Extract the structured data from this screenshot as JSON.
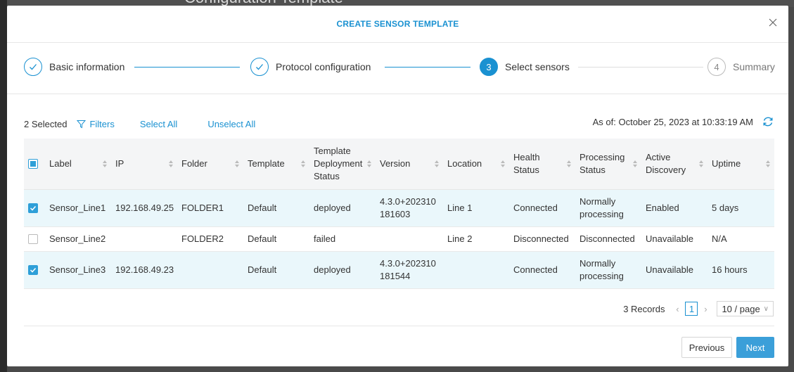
{
  "background": {
    "title": "Configuration Template"
  },
  "modal": {
    "title": "CREATE SENSOR TEMPLATE"
  },
  "steps": [
    {
      "number": "",
      "label": "Basic information",
      "state": "done"
    },
    {
      "number": "",
      "label": "Protocol configuration",
      "state": "done"
    },
    {
      "number": "3",
      "label": "Select sensors",
      "state": "active"
    },
    {
      "number": "4",
      "label": "Summary",
      "state": "pending"
    }
  ],
  "toolbar": {
    "selected": "2 Selected",
    "filters": "Filters",
    "select_all": "Select All",
    "unselect_all": "Unselect All",
    "as_of": "As of: October 25, 2023 at 10:33:19 AM"
  },
  "table": {
    "columns": [
      "Label",
      "IP",
      "Folder",
      "Template",
      "Template Deployment Status",
      "Version",
      "Location",
      "Health Status",
      "Processing Status",
      "Active Discovery",
      "Uptime"
    ],
    "rows": [
      {
        "checked": true,
        "label": "Sensor_Line1",
        "ip": "192.168.49.25",
        "folder": "FOLDER1",
        "template": "Default",
        "deploy": "deployed",
        "version": "4.3.0+202310181603",
        "location": "Line 1",
        "health": "Connected",
        "processing": "Normally processing",
        "discovery": "Enabled",
        "uptime": "5 days"
      },
      {
        "checked": false,
        "label": "Sensor_Line2",
        "ip": "",
        "folder": "FOLDER2",
        "template": "Default",
        "deploy": "failed",
        "version": "",
        "location": "Line 2",
        "health": "Disconnected",
        "processing": "Disconnected",
        "discovery": "Unavailable",
        "uptime": "N/A"
      },
      {
        "checked": true,
        "label": "Sensor_Line3",
        "ip": "192.168.49.23",
        "folder": "",
        "template": "Default",
        "deploy": "deployed",
        "version": "4.3.0+202310181544",
        "location": "",
        "health": "Connected",
        "processing": "Normally processing",
        "discovery": "Unavailable",
        "uptime": "16 hours"
      }
    ]
  },
  "pagination": {
    "records": "3 Records",
    "page": "1",
    "page_size": "10 / page"
  },
  "buttons": {
    "previous": "Previous",
    "next": "Next"
  },
  "colors": {
    "accent": "#1a91d1",
    "selected_row": "#eaf7fb",
    "next_button": "#3b9fd9"
  }
}
